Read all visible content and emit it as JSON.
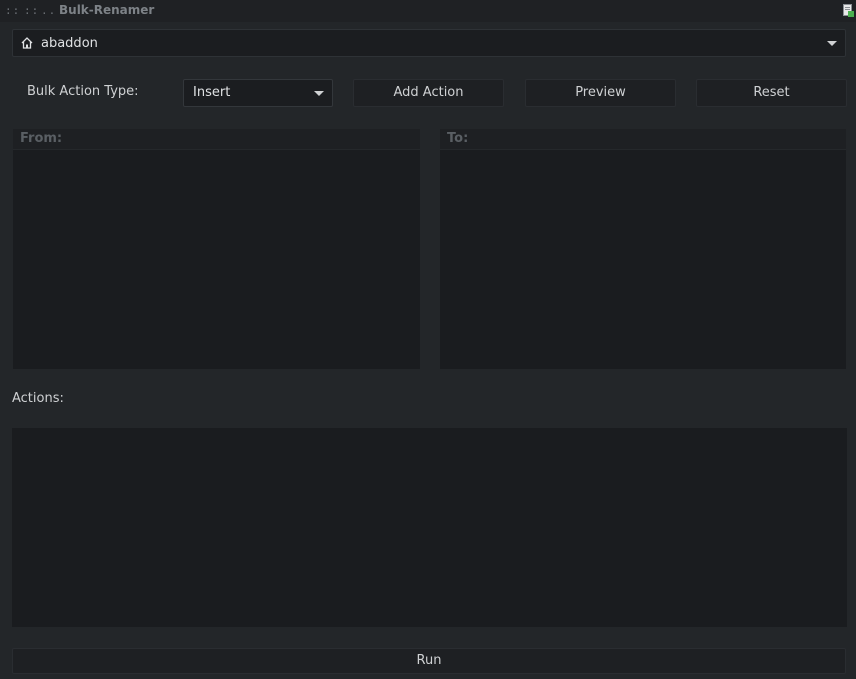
{
  "titlebar": {
    "title": "Bulk-Renamer",
    "grips": [
      "::",
      "::",
      ".."
    ],
    "corner_icon": "window-app-icon"
  },
  "location": {
    "icon": "home-icon",
    "value": "abaddon"
  },
  "toolbar": {
    "action_type_label": "Bulk Action Type:",
    "action_type_value": "Insert",
    "add_action_label": "Add Action",
    "preview_label": "Preview",
    "reset_label": "Reset"
  },
  "panels": {
    "from_label": "From:",
    "to_label": "To:"
  },
  "actions": {
    "label": "Actions:"
  },
  "footer": {
    "run_label": "Run"
  },
  "colors": {
    "background": "#232629",
    "field": "#1b1d20",
    "panel": "#1a1c1f",
    "text": "#d0d2d4",
    "muted_header": "#5a5f64"
  }
}
